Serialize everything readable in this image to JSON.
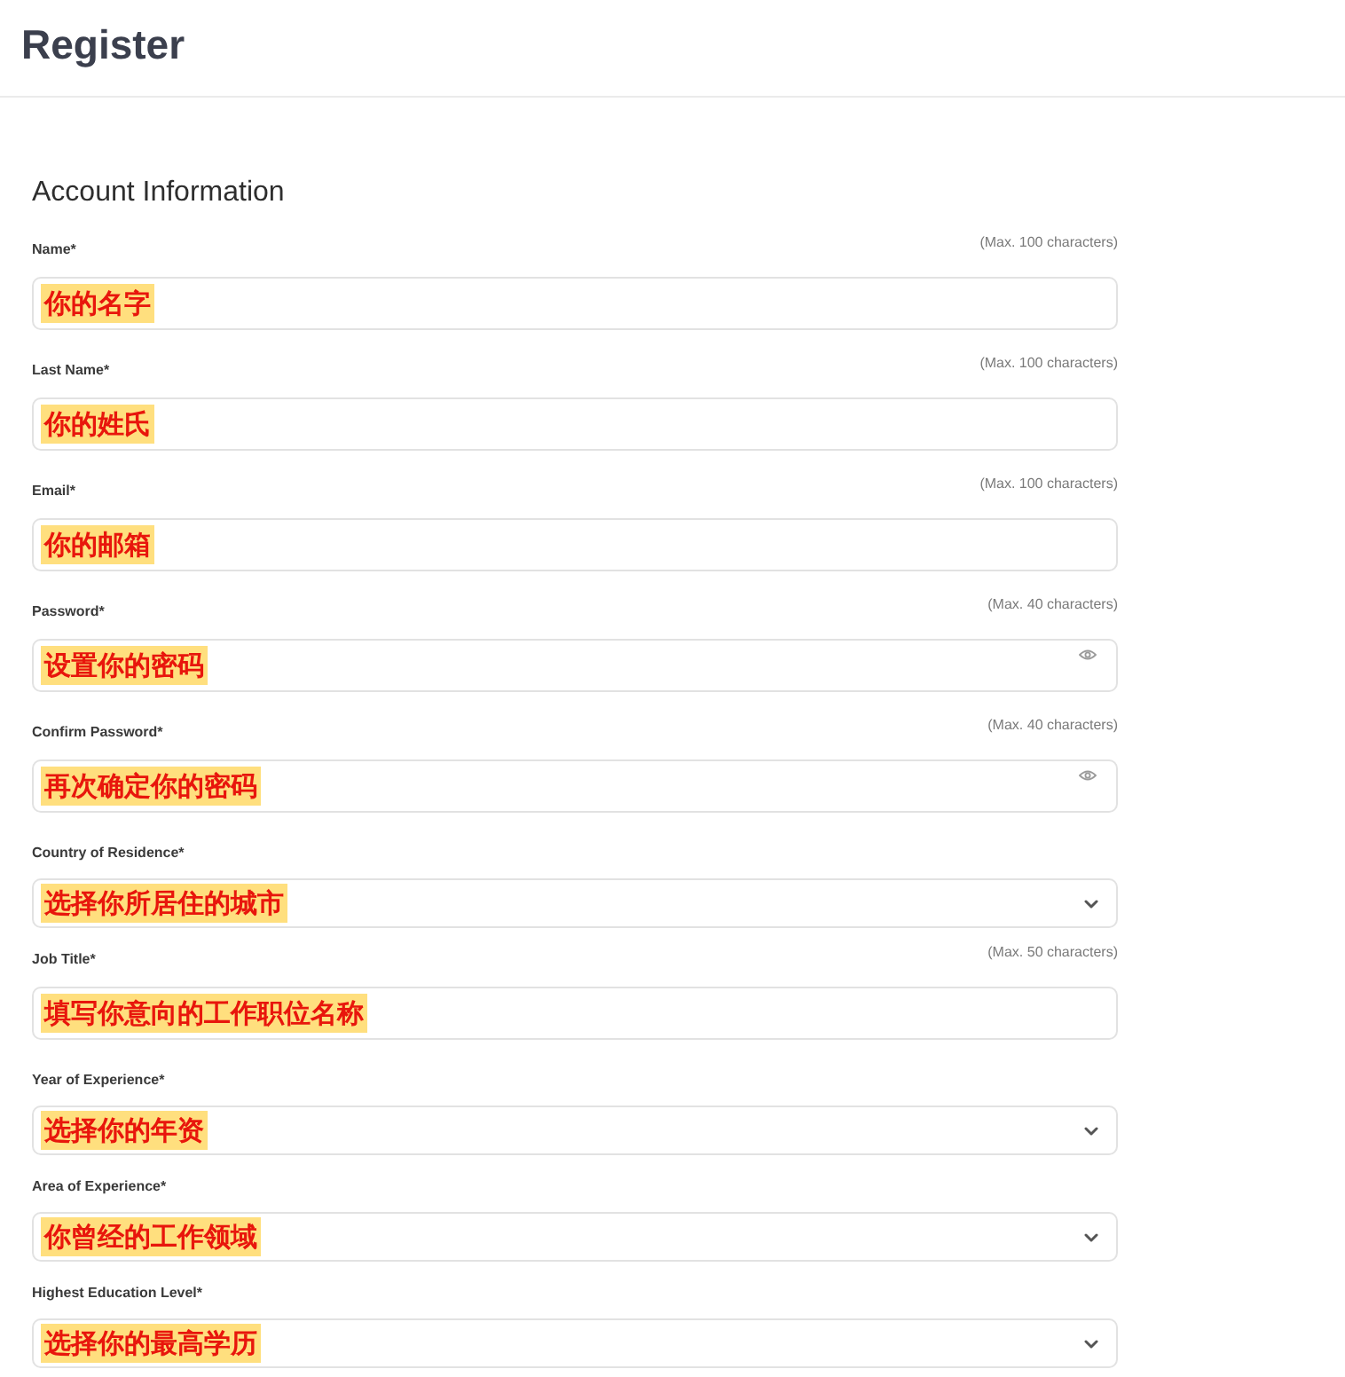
{
  "header": {
    "title": "Register"
  },
  "section": {
    "title": "Account Information",
    "fields": [
      {
        "kind": "text",
        "label": "Name*",
        "hint": "(Max. 100 characters)",
        "value": "你的名字"
      },
      {
        "kind": "text",
        "label": "Last Name*",
        "hint": "(Max. 100 characters)",
        "value": "你的姓氏"
      },
      {
        "kind": "text",
        "label": "Email*",
        "hint": "(Max. 100 characters)",
        "value": "你的邮箱"
      },
      {
        "kind": "password",
        "label": "Password*",
        "hint": "(Max. 40 characters)",
        "value": "设置你的密码"
      },
      {
        "kind": "password",
        "label": "Confirm Password*",
        "hint": "(Max. 40 characters)",
        "value": "再次确定你的密码"
      },
      {
        "kind": "select",
        "label": "Country of Residence*",
        "value": "选择你所居住的城市"
      },
      {
        "kind": "text",
        "label": "Job Title*",
        "hint": "(Max. 50 characters)",
        "value": "填写你意向的工作职位名称"
      },
      {
        "kind": "select",
        "label": "Year of Experience*",
        "value": "选择你的年资"
      },
      {
        "kind": "select",
        "label": "Area of Experience*",
        "value": "你曾经的工作领域"
      },
      {
        "kind": "select",
        "label": "Highest Education Level*",
        "value": "选择你的最高学历"
      }
    ]
  }
}
